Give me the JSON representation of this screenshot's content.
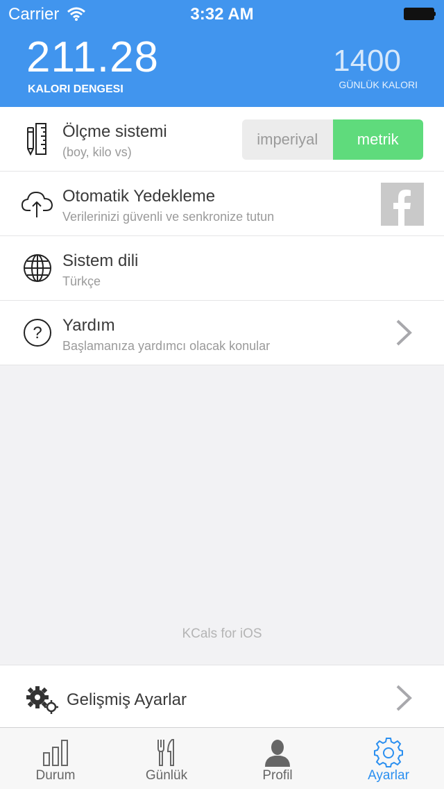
{
  "status_bar": {
    "carrier": "Carrier",
    "time": "3:32 AM"
  },
  "header": {
    "balance_value": "211.28",
    "balance_label": "KALORI DENGESI",
    "daily_value": "1400",
    "daily_label": "GÜNLÜK KALORI"
  },
  "settings": [
    {
      "title": "Ölçme sistemi",
      "subtitle": "(boy, kilo vs)",
      "icon": "ruler-pencil-icon"
    },
    {
      "title": "Otomatik Yedekleme",
      "subtitle": "Verilerinizi güvenli ve senkronize tutun",
      "icon": "cloud-upload-icon"
    },
    {
      "title": "Sistem dili",
      "subtitle": "Türkçe",
      "icon": "globe-icon"
    },
    {
      "title": "Yardım",
      "subtitle": "Başlamanıza yardımcı olacak konular",
      "icon": "help-icon"
    }
  ],
  "unit_toggle": {
    "imperial_label": "imperiyal",
    "metric_label": "metrik",
    "selected": "metrik"
  },
  "footer_text": "KCals for iOS",
  "advanced": {
    "title": "Gelişmiş Ayarlar"
  },
  "tabs": [
    {
      "label": "Durum",
      "icon": "bar-chart-icon",
      "active": false
    },
    {
      "label": "Günlük",
      "icon": "fork-knife-icon",
      "active": false
    },
    {
      "label": "Profil",
      "icon": "person-icon",
      "active": false
    },
    {
      "label": "Ayarlar",
      "icon": "gear-icon",
      "active": true
    }
  ],
  "colors": {
    "header": "#4195ee",
    "toggle_active": "#5fdb7c",
    "tab_active": "#2a8ff0",
    "facebook_tile": "#c9c9c9"
  }
}
